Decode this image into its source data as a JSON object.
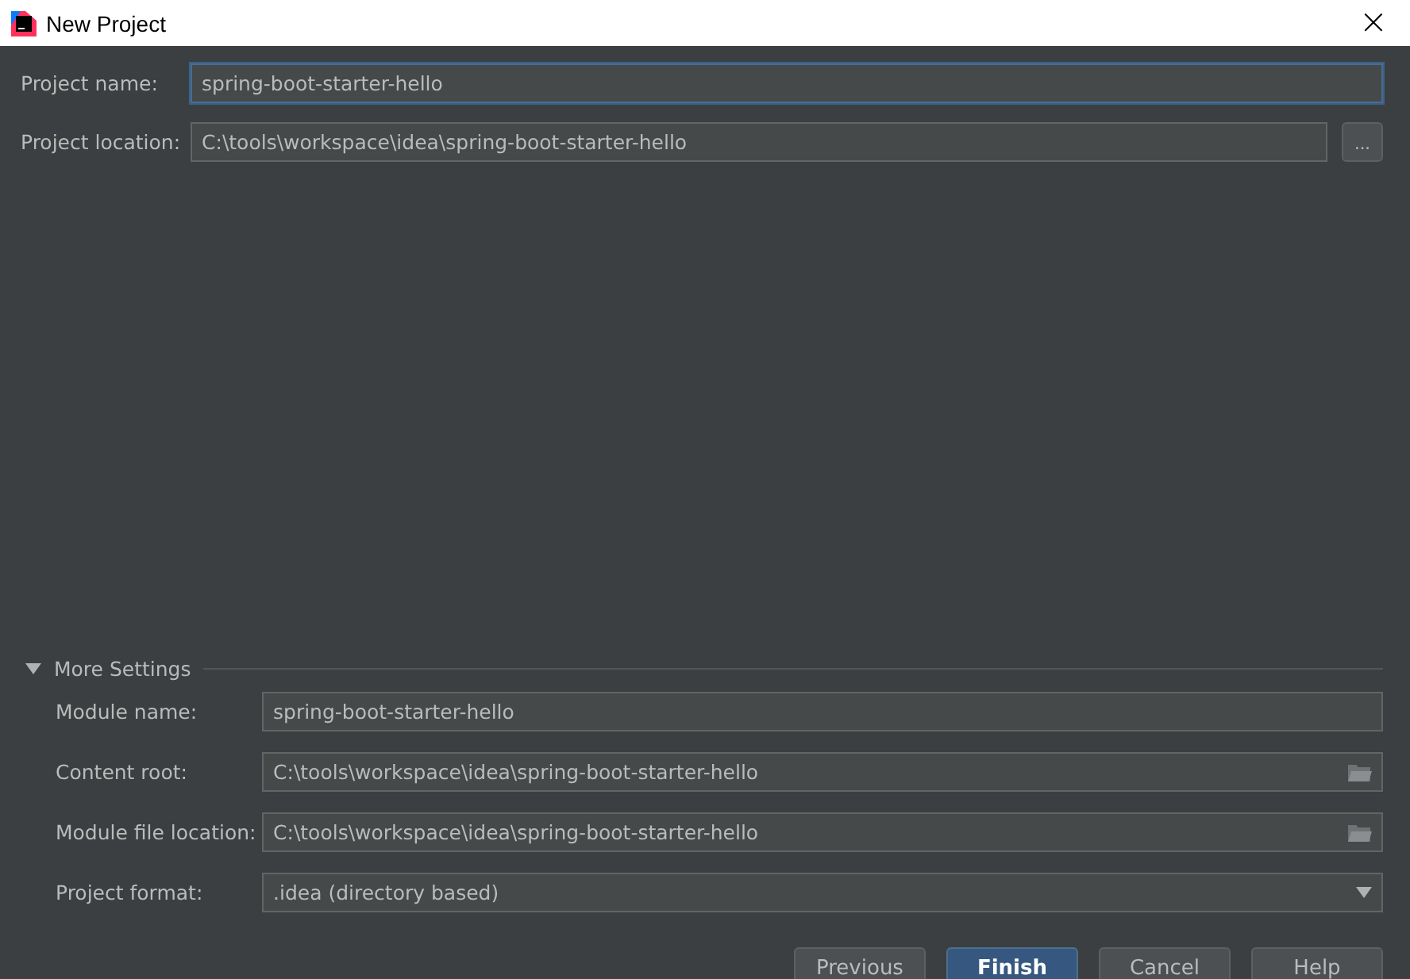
{
  "window": {
    "title": "New Project",
    "close": "×"
  },
  "top_fields": [
    {
      "label": "Project name:",
      "value": "spring-boot-starter-hello",
      "focused": true
    },
    {
      "label": "Project location:",
      "value": "C:\\tools\\workspace\\idea\\spring-boot-starter-hello",
      "focused": false,
      "browse": "..."
    }
  ],
  "more_settings": {
    "title": "More Settings",
    "expanded": true,
    "rows": [
      {
        "kind": "text",
        "label": "Module name:",
        "value": "spring-boot-starter-hello"
      },
      {
        "kind": "folder",
        "label": "Content root:",
        "value": "C:\\tools\\workspace\\idea\\spring-boot-starter-hello"
      },
      {
        "kind": "folder",
        "label": "Module file location:",
        "value": "C:\\tools\\workspace\\idea\\spring-boot-starter-hello"
      },
      {
        "kind": "dropdown",
        "label": "Project format:",
        "value": ".idea (directory based)"
      }
    ]
  },
  "buttons": [
    {
      "label": "Previous",
      "default": false
    },
    {
      "label": "Finish",
      "default": true
    },
    {
      "label": "Cancel",
      "default": false
    },
    {
      "label": "Help",
      "default": false
    }
  ]
}
